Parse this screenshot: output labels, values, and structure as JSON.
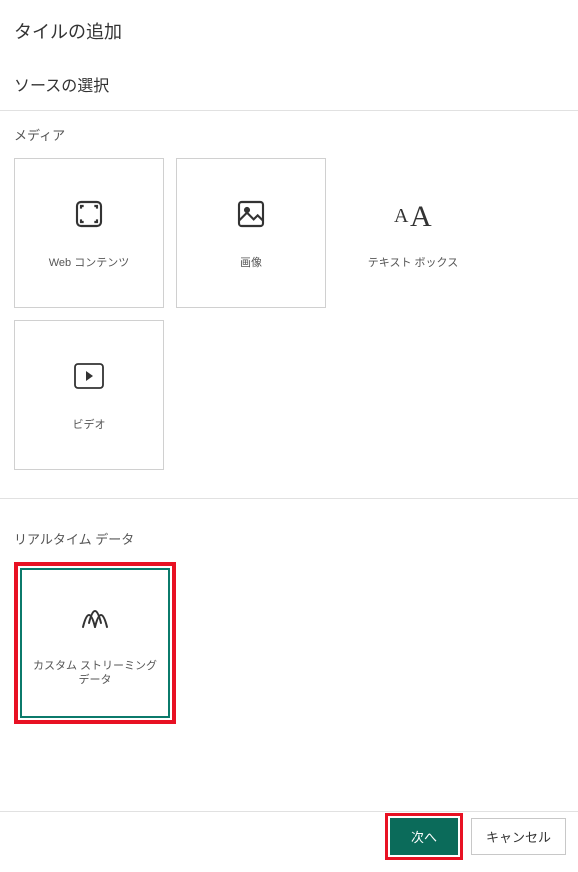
{
  "header": {
    "title": "タイルの追加",
    "subtitle": "ソースの選択"
  },
  "sections": {
    "media": {
      "label": "メディア",
      "tiles": [
        {
          "label": "Web コンテンツ",
          "icon": "fullscreen-icon"
        },
        {
          "label": "画像",
          "icon": "image-icon"
        },
        {
          "label": "テキスト ボックス",
          "icon": "textbox-icon"
        },
        {
          "label": "ビデオ",
          "icon": "video-icon"
        }
      ]
    },
    "realtime": {
      "label": "リアルタイム データ",
      "tiles": [
        {
          "label": "カスタム ストリーミング データ",
          "icon": "streaming-icon",
          "selected": true
        }
      ]
    }
  },
  "footer": {
    "next_label": "次へ",
    "cancel_label": "キャンセル"
  }
}
